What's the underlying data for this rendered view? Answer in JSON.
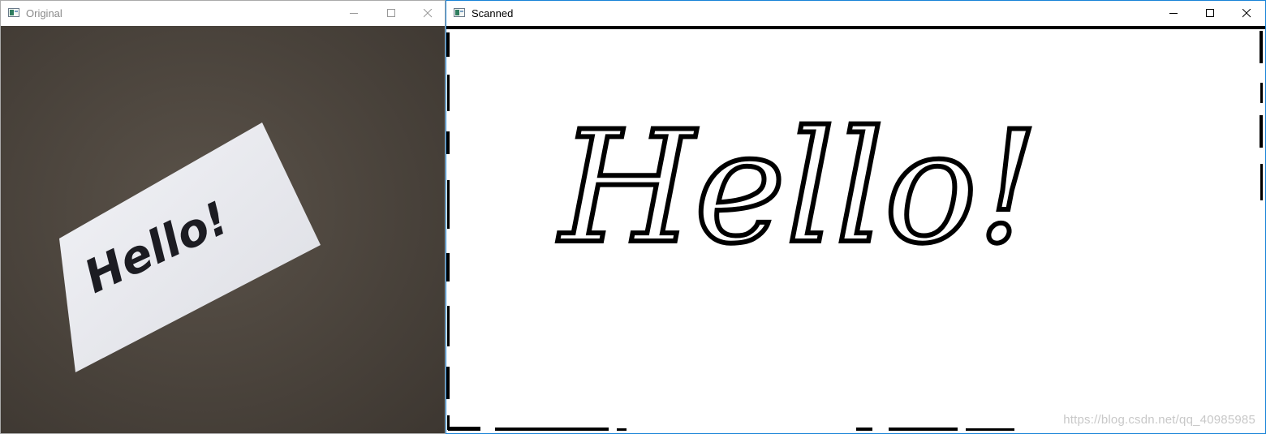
{
  "windows": {
    "original": {
      "title": "Original",
      "icon": "app-window-icon"
    },
    "scanned": {
      "title": "Scanned",
      "icon": "app-window-icon"
    }
  },
  "controls": [
    "minimize",
    "maximize",
    "close"
  ],
  "note": {
    "text": "Hello!"
  },
  "watermark": {
    "text": "https://blog.csdn.net/qq_40985985"
  },
  "colors": {
    "desk": "#4a433c",
    "paper": "#ecedf1",
    "ink": "#000000",
    "active_border": "#1883d7"
  }
}
